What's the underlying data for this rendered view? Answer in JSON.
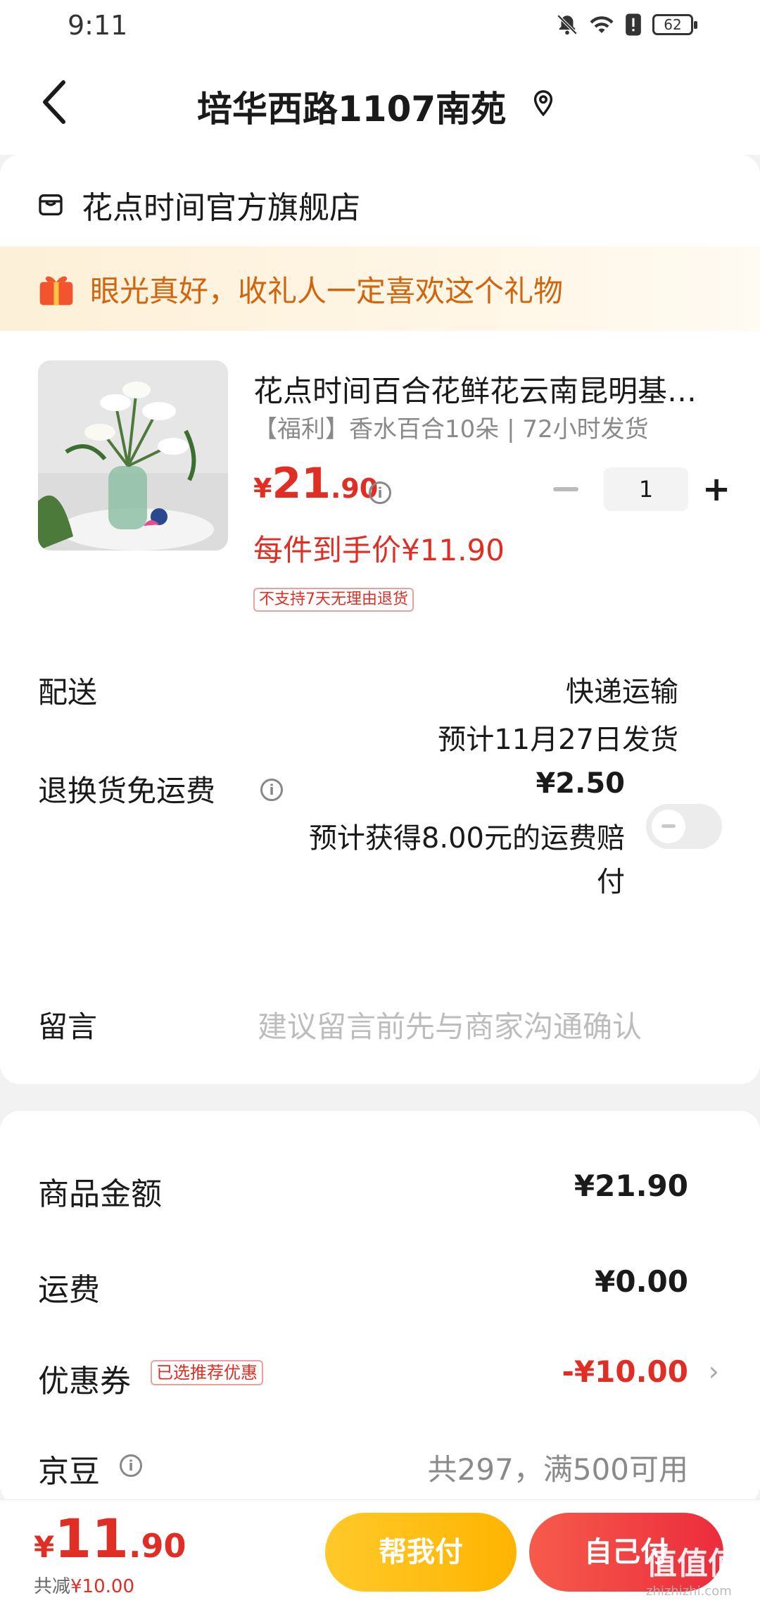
{
  "status_bar": {
    "time": "9:11",
    "battery": "62"
  },
  "header": {
    "title": "培华西路1107南苑"
  },
  "store": {
    "name": "花点时间官方旗舰店"
  },
  "gift_banner": {
    "text": "眼光真好，收礼人一定喜欢这个礼物"
  },
  "product": {
    "title": "花点时间百合花鲜花云南昆明基地直发",
    "spec": "【福利】香水百合10朵 | 72小时发货",
    "price_currency": "¥",
    "price_integer": "21",
    "price_decimal": ".90",
    "quantity": "1",
    "unit_price": "每件到手价¥11.90",
    "no_return_tag": "不支持7天无理由退货"
  },
  "delivery": {
    "label": "配送",
    "method": "快递运输",
    "estimate": "预计11月27日发货"
  },
  "return_shipping": {
    "label": "退换货免运费",
    "price": "¥2.50",
    "desc_line1": "预计获得8.00元的运费赔",
    "desc_line2": "付",
    "toggle_on": false
  },
  "message": {
    "label": "留言",
    "placeholder": "建议留言前先与商家沟通确认"
  },
  "summary": {
    "goods_label": "商品金额",
    "goods_value": "¥21.90",
    "shipping_label": "运费",
    "shipping_value": "¥0.00",
    "coupon_label": "优惠券",
    "coupon_badge": "已选推荐优惠",
    "coupon_value": "-¥10.00",
    "beans_label": "京豆",
    "beans_value": "共297，满500可用"
  },
  "bottom": {
    "total_currency": "¥",
    "total_integer": "11",
    "total_decimal": ".90",
    "saved_label": "共减",
    "saved_amount": "¥10.00",
    "help_pay": "帮我付",
    "self_pay": "自己付"
  },
  "watermark": {
    "main": "值值值",
    "sub": "zhizhizhi.com"
  },
  "colors": {
    "accent_red": "#e02e24",
    "gift_orange": "#d2650b",
    "help_yellow": "#ffc92a",
    "self_red": "#ec2c3c"
  }
}
